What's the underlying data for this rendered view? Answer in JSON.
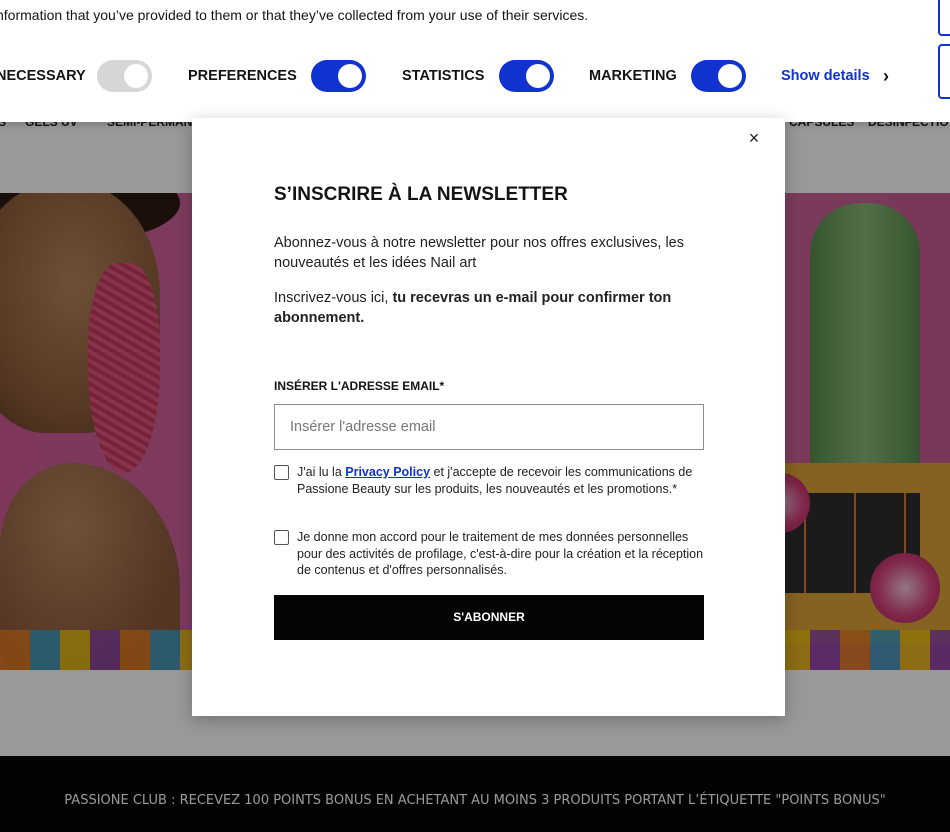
{
  "cookie_banner": {
    "text": "nformation that you’ve provided to them or that they’ve collected from your use of their services.",
    "toggles": [
      {
        "label": "NECESSARY",
        "on": true,
        "disabled": true
      },
      {
        "label": "PREFERENCES",
        "on": true,
        "disabled": false
      },
      {
        "label": "STATISTICS",
        "on": true,
        "disabled": false
      },
      {
        "label": "MARKETING",
        "on": true,
        "disabled": false
      }
    ],
    "show_details": "Show details",
    "chevron": "›"
  },
  "nav": {
    "items": [
      "S",
      "GELS UV",
      "SEMI-PERMAN",
      "CAPSULES",
      "DÉSINFECTIO"
    ]
  },
  "newsletter": {
    "close": "×",
    "title": "S’INSCRIRE À LA NEWSLETTER",
    "intro": "Abonnez-vous à notre newsletter pour nos offres exclusives, les nouveautés et les idées Nail art",
    "signup_lead": "Inscrivez-vous ici, ",
    "signup_bold": "tu recevras un e-mail pour confirmer ton abonnement.",
    "email_label": "INSÉRER L'ADRESSE EMAIL*",
    "email_placeholder": "Insérer l'adresse email",
    "email_value": "",
    "consent1_pre": "J'ai lu la ",
    "consent1_link": "Privacy Policy",
    "consent1_post": " et j'accepte de recevoir les communications de Passione Beauty sur les produits, les nouveautés et les promotions.*",
    "consent2": "Je donne mon accord pour le traitement de mes données personnelles pour des activités de profilage, c'est-à-dire pour la création et la réception de contenus et d'offres personnalisés.",
    "subscribe": "S'ABONNER"
  },
  "promo": {
    "line": "PASSIONE CLUB : RECEVEZ 100 POINTS BONUS EN ACHETANT AU MOINS 3 PRODUITS PORTANT L’ÉTIQUETTE \"POINTS BONUS\""
  },
  "colors": {
    "accent": "#1032cf",
    "toggle_disabled": "#d6d6d6",
    "dark": "#050505"
  }
}
